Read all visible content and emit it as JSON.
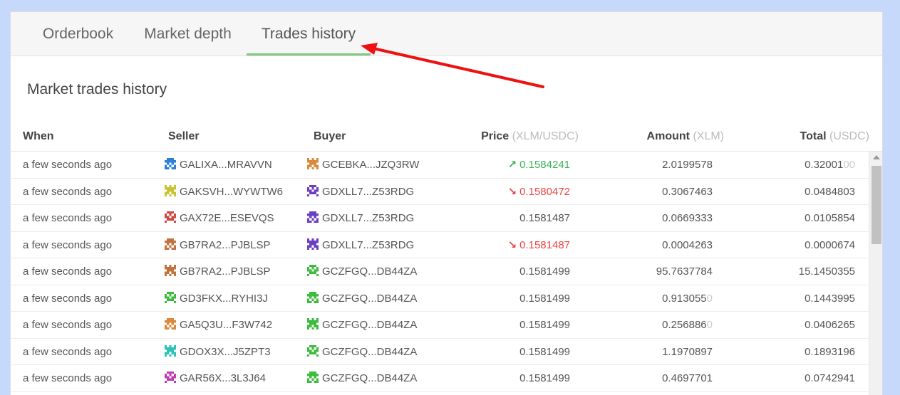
{
  "tabs": [
    {
      "label": "Orderbook",
      "active": false
    },
    {
      "label": "Market depth",
      "active": false
    },
    {
      "label": "Trades history",
      "active": true
    }
  ],
  "section_title": "Market trades history",
  "columns": {
    "when": "When",
    "seller": "Seller",
    "buyer": "Buyer",
    "price": "Price",
    "price_unit": "(XLM/USDC)",
    "amount": "Amount",
    "amount_unit": "(XLM)",
    "total": "Total",
    "total_unit": "(USDC)"
  },
  "colors": {
    "up": "#3bb45b",
    "down": "#ee4444",
    "tab_underline": "#7fc67f",
    "annotation_arrow": "#ee1111"
  },
  "trades": [
    {
      "when": "a few seconds ago",
      "seller": "GALIXA...MRAVVN",
      "buyer": "GCEBKA...JZQ3RW",
      "price": "0.1584241",
      "direction": "up",
      "amount": "2.0199578",
      "amount_tail": "",
      "total": "0.32001",
      "total_tail": "00",
      "seller_icon": "identicon-blue",
      "buyer_icon": "identicon-orange"
    },
    {
      "when": "a few seconds ago",
      "seller": "GAKSVH...WYWTW6",
      "buyer": "GDXLL7...Z53RDG",
      "price": "0.1580472",
      "direction": "down",
      "amount": "0.3067463",
      "amount_tail": "",
      "total": "0.0484803",
      "total_tail": "",
      "seller_icon": "identicon-yellow",
      "buyer_icon": "identicon-purple"
    },
    {
      "when": "a few seconds ago",
      "seller": "GAX72E...ESEVQS",
      "buyer": "GDXLL7...Z53RDG",
      "price": "0.1581487",
      "direction": "none",
      "amount": "0.0669333",
      "amount_tail": "",
      "total": "0.0105854",
      "total_tail": "",
      "seller_icon": "identicon-red",
      "buyer_icon": "identicon-purple"
    },
    {
      "when": "a few seconds ago",
      "seller": "GB7RA2...PJBLSP",
      "buyer": "GDXLL7...Z53RDG",
      "price": "0.1581487",
      "direction": "down",
      "amount": "0.0004263",
      "amount_tail": "",
      "total": "0.0000674",
      "total_tail": "",
      "seller_icon": "identicon-brown",
      "buyer_icon": "identicon-purple"
    },
    {
      "when": "a few seconds ago",
      "seller": "GB7RA2...PJBLSP",
      "buyer": "GCZFGQ...DB44ZA",
      "price": "0.1581499",
      "direction": "none",
      "amount": "95.7637784",
      "amount_tail": "",
      "total": "15.1450355",
      "total_tail": "",
      "seller_icon": "identicon-brown",
      "buyer_icon": "identicon-green"
    },
    {
      "when": "a few seconds ago",
      "seller": "GD3FKX...RYHI3J",
      "buyer": "GCZFGQ...DB44ZA",
      "price": "0.1581499",
      "direction": "none",
      "amount": "0.913055",
      "amount_tail": "0",
      "total": "0.1443995",
      "total_tail": "",
      "seller_icon": "identicon-green",
      "buyer_icon": "identicon-green"
    },
    {
      "when": "a few seconds ago",
      "seller": "GA5Q3U...F3W742",
      "buyer": "GCZFGQ...DB44ZA",
      "price": "0.1581499",
      "direction": "none",
      "amount": "0.256886",
      "amount_tail": "0",
      "total": "0.0406265",
      "total_tail": "",
      "seller_icon": "identicon-orange",
      "buyer_icon": "identicon-green"
    },
    {
      "when": "a few seconds ago",
      "seller": "GDOX3X...J5ZPT3",
      "buyer": "GCZFGQ...DB44ZA",
      "price": "0.1581499",
      "direction": "none",
      "amount": "1.1970897",
      "amount_tail": "",
      "total": "0.1893196",
      "total_tail": "",
      "seller_icon": "identicon-teal",
      "buyer_icon": "identicon-green"
    },
    {
      "when": "a few seconds ago",
      "seller": "GAR56X...3L3J64",
      "buyer": "GCZFGQ...DB44ZA",
      "price": "0.1581499",
      "direction": "none",
      "amount": "0.4697701",
      "amount_tail": "",
      "total": "0.0742941",
      "total_tail": "",
      "seller_icon": "identicon-magenta",
      "buyer_icon": "identicon-green"
    }
  ],
  "icon_colors": {
    "identicon-blue": "#2a7fd6",
    "identicon-orange": "#d98a3a",
    "identicon-yellow": "#c9c234",
    "identicon-purple": "#6b3fc4",
    "identicon-red": "#d0453f",
    "identicon-brown": "#c2723c",
    "identicon-green": "#3dbb3d",
    "identicon-teal": "#2fc2b8",
    "identicon-magenta": "#c33bb0"
  }
}
